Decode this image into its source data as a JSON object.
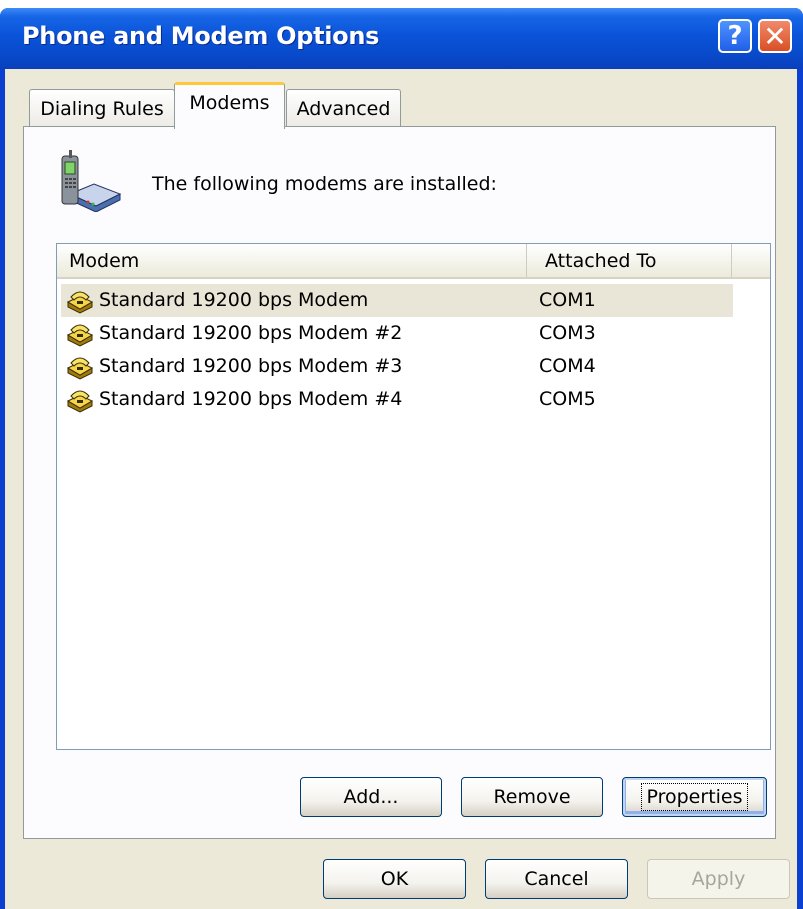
{
  "window": {
    "title": "Phone and Modem Options",
    "help_glyph": "?",
    "close_glyph": "✕"
  },
  "tabs": [
    {
      "label": "Dialing Rules",
      "active": false
    },
    {
      "label": "Modems",
      "active": true
    },
    {
      "label": "Advanced",
      "active": false
    }
  ],
  "panel": {
    "icon": "phone-modem-icon",
    "header_text": "The following modems are  installed:"
  },
  "list": {
    "columns": [
      "Modem",
      "Attached To"
    ],
    "rows": [
      {
        "icon": "modem-icon",
        "name": "Standard 19200 bps Modem",
        "port": "COM1",
        "selected": true
      },
      {
        "icon": "modem-icon",
        "name": "Standard 19200 bps Modem #2",
        "port": "COM3",
        "selected": false
      },
      {
        "icon": "modem-icon",
        "name": "Standard 19200 bps Modem #3",
        "port": "COM4",
        "selected": false
      },
      {
        "icon": "modem-icon",
        "name": "Standard 19200 bps Modem #4",
        "port": "COM5",
        "selected": false
      }
    ]
  },
  "panel_buttons": {
    "add": "Add...",
    "remove": "Remove",
    "properties": "Properties"
  },
  "dialog_buttons": {
    "ok": "OK",
    "cancel": "Cancel",
    "apply": "Apply",
    "apply_enabled": false
  },
  "colors": {
    "titlebar": "#0a53d9",
    "face": "#ece9d8",
    "tab_highlight": "#ffc83c",
    "selected_row": "#e9e6d7"
  }
}
